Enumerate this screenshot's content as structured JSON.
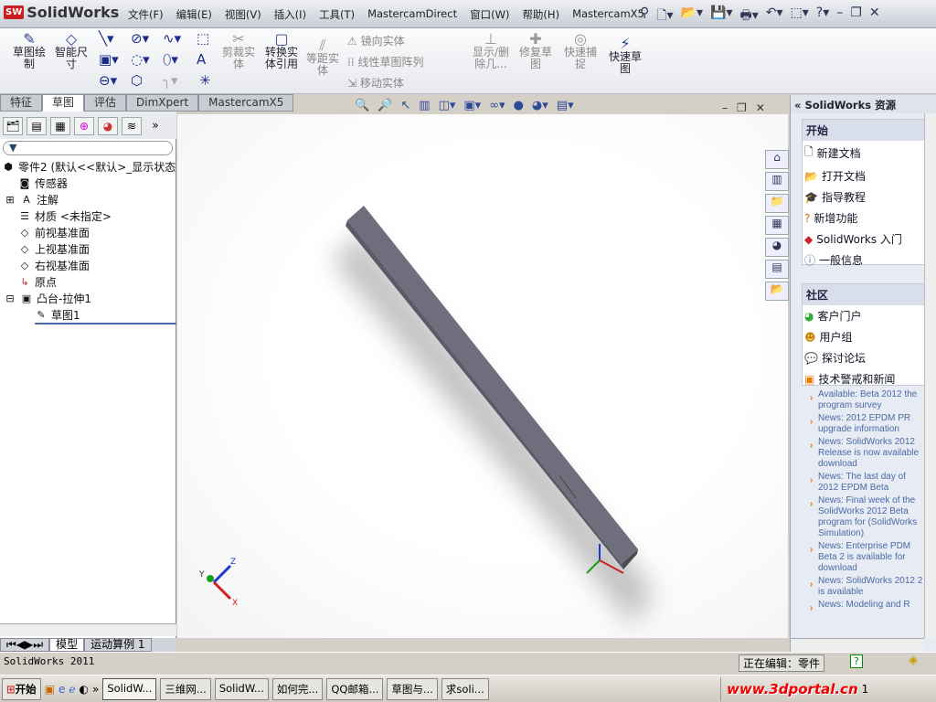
{
  "app": {
    "logo_text": "SolidWorks"
  },
  "menu": [
    "文件(F)",
    "编辑(E)",
    "视图(V)",
    "插入(I)",
    "工具(T)",
    "MastercamDirect",
    "窗口(W)",
    "帮助(H)",
    "MastercamX5"
  ],
  "ribbon": {
    "sketch": "草图绘制",
    "smart_dim": "智能尺寸",
    "trim": "剪裁实体",
    "convert": "转换实体引用",
    "offset": "等距实体",
    "mirror": "镜向实体",
    "linear_pattern": "线性草图阵列",
    "move": "移动实体",
    "show_delete": "显示/删除几...",
    "repair": "修复草图",
    "quick_snap": "快速捕捉",
    "rapid_sketch": "快速草图"
  },
  "tabs": [
    "特征",
    "草图",
    "评估",
    "DimXpert",
    "MastercamX5"
  ],
  "active_tab": "草图",
  "tree": {
    "root": "零件2  (默认<<默认>_显示状态",
    "items": [
      "传感器",
      "注解",
      "材质 <未指定>",
      "前视基准面",
      "上视基准面",
      "右视基准面",
      "原点",
      "凸台-拉伸1",
      "草图1"
    ]
  },
  "bottom_tabs": [
    "模型",
    "运动算例 1"
  ],
  "triad": {
    "x": "X",
    "y": "Y",
    "z": "Z"
  },
  "taskpane": {
    "title": "SolidWorks 资源",
    "start_title": "开始",
    "start_items": [
      "新建文档",
      "打开文档",
      "指导教程",
      "新增功能",
      "SolidWorks 入门",
      "一般信息"
    ],
    "community_title": "社区",
    "community_items": [
      "客户门户",
      "用户组",
      "探讨论坛",
      "技术警戒和新闻"
    ],
    "news": [
      "Available: Beta 2012 the program survey",
      "News: 2012 EPDM PR upgrade information",
      "News: SolidWorks 2012 Release is now available download",
      "News: The last day of 2012 EPDM Beta",
      "News: Final week of the SolidWorks 2012 Beta program for (SolidWorks Simulation)",
      "News: Enterprise PDM Beta 2 is available for download",
      "News: SolidWorks 2012 2 is available",
      "News: Modeling and R"
    ]
  },
  "status": {
    "left": "SolidWorks 2011",
    "editing": "正在编辑：零件"
  },
  "taskbar": {
    "start": "开始",
    "items": [
      "SolidW...",
      "三维网...",
      "SolidW...",
      "如何完...",
      "QQ邮箱...",
      "草图与...",
      "求soli..."
    ],
    "watermark": "www.3dportal.cn",
    "clock": "1"
  }
}
